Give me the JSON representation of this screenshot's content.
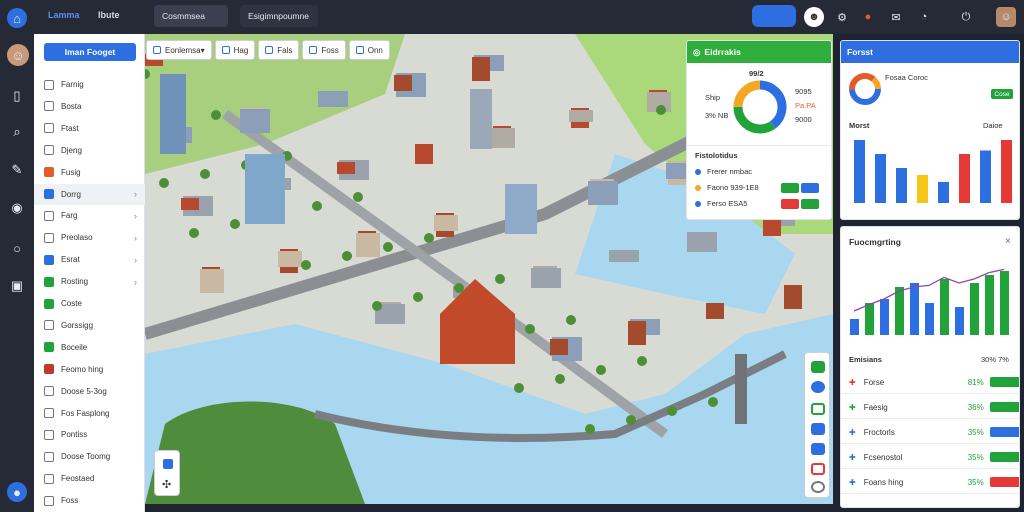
{
  "app": {
    "logo": "Lamma",
    "section": "Ibute",
    "project": "Cosmmsea",
    "search": "Esigimnpoumne"
  },
  "sidebar": {
    "new_button": "Iman Fooget",
    "items": [
      {
        "label": "Farnig",
        "icon": "pin-icon",
        "color": "#777"
      },
      {
        "label": "Bosta",
        "icon": "doc-icon",
        "color": "#777"
      },
      {
        "label": "Ftast",
        "icon": "box-icon",
        "color": "#777"
      },
      {
        "label": "Djeng",
        "icon": "pen-icon",
        "color": "#777"
      },
      {
        "label": "Fusig",
        "icon": "flame-icon",
        "color": "#e25c2b"
      },
      {
        "label": "Dorrg",
        "icon": "layer-icon",
        "color": "#2d6fe0",
        "active": true
      },
      {
        "label": "Farg",
        "icon": "square-icon",
        "color": "#777"
      },
      {
        "label": "Preolaso",
        "icon": "square-icon",
        "color": "#777"
      },
      {
        "label": "Esrat",
        "icon": "grid-icon",
        "color": "#2d6fe0"
      },
      {
        "label": "Rosting",
        "icon": "green-square-icon",
        "color": "#22a33a"
      },
      {
        "label": "Coste",
        "icon": "square-icon",
        "color": "#22a33a"
      },
      {
        "label": "Gorssigg",
        "icon": "square-icon",
        "color": "#777"
      },
      {
        "label": "Boceile",
        "icon": "green-square-icon",
        "color": "#22a33a"
      },
      {
        "label": "Feomo hing",
        "icon": "image-icon",
        "color": "#c0392b"
      },
      {
        "label": "Doose 5-3og",
        "icon": "square-icon",
        "color": "#777"
      },
      {
        "label": "Fos Fasplong",
        "icon": "square-icon",
        "color": "#777"
      },
      {
        "label": "Pontiss",
        "icon": "square-icon",
        "color": "#777"
      },
      {
        "label": "Doose Toomg",
        "icon": "square-icon",
        "color": "#777"
      },
      {
        "label": "Feostaed",
        "icon": "square-icon",
        "color": "#777"
      },
      {
        "label": "Foss",
        "icon": "square-icon",
        "color": "#777"
      }
    ]
  },
  "map_tools": [
    "Eonlemsa",
    "Hag",
    "Fals",
    "Foss",
    "Onn"
  ],
  "panel_summary": {
    "title": "Eidrrakis",
    "center_label": "99/2",
    "left_labels": [
      "Ship",
      "3% NB"
    ],
    "right_labels": [
      "9095",
      "Pa.PA",
      "9000"
    ],
    "donut": [
      {
        "value": 40,
        "color": "#2d6fe0"
      },
      {
        "value": 35,
        "color": "#22a33a"
      },
      {
        "value": 25,
        "color": "#f5a623"
      }
    ],
    "list_title": "Fistolotidus",
    "list": [
      {
        "label": "Frerer nmbac",
        "dot": "#2d6fe0"
      },
      {
        "label": "Faono 939-1E8",
        "badge1": "#22a33a",
        "badge2": "#2d6fe0",
        "dot": "#f5a623"
      },
      {
        "label": "Ferso ESA5",
        "badge1": "#e53935",
        "badge2": "#22a33a",
        "dot": "#2d6fe0"
      }
    ]
  },
  "panel_bar": {
    "title": "Forsst",
    "row1": "Fosaa Coroc",
    "row1_badge": "Cose",
    "chart_label": "Morst",
    "chart_value": "Daioe"
  },
  "panel_trend": {
    "title": "Fuocmgrting",
    "kpi_header": "Emisians",
    "kpi_header_value": "30% 7%",
    "kpis": [
      {
        "label": "Forse",
        "value": "81%",
        "badge": "#22a33a",
        "icon": "#e53935"
      },
      {
        "label": "Faesig",
        "value": "36%",
        "badge": "#22a33a",
        "icon": "#22a33a"
      },
      {
        "label": "Froctorls",
        "value": "35%",
        "badge": "#2d6fe0",
        "icon": "#2d6fe0"
      },
      {
        "label": "Fcsenostol",
        "value": "35%",
        "badge": "#22a33a",
        "icon": "#2d6fe0"
      },
      {
        "label": "Foans hing",
        "value": "35%",
        "badge": "#e53935",
        "icon": "#2d6fe0"
      }
    ]
  },
  "chart_data": [
    {
      "type": "bar",
      "title": "",
      "values": [
        90,
        70,
        50,
        40,
        30,
        70,
        75,
        90
      ],
      "colors": [
        "#2d6fe0",
        "#2d6fe0",
        "#2d6fe0",
        "#f5c518",
        "#2d6fe0",
        "#e53935",
        "#2d6fe0",
        "#e53935"
      ],
      "ylim": [
        0,
        100
      ]
    },
    {
      "type": "bar",
      "title": "",
      "bars": [
        20,
        40,
        45,
        60,
        65,
        40,
        70,
        35,
        65,
        75,
        80
      ],
      "line": [
        30,
        38,
        45,
        55,
        60,
        62,
        72,
        65,
        70,
        78,
        82
      ],
      "colors": [
        "#2d6fe0",
        "#22a33a",
        "#2d6fe0",
        "#22a33a",
        "#2d6fe0",
        "#2d6fe0",
        "#22a33a",
        "#2d6fe0",
        "#22a33a",
        "#22a33a",
        "#22a33a"
      ],
      "ylim": [
        0,
        100
      ]
    }
  ]
}
